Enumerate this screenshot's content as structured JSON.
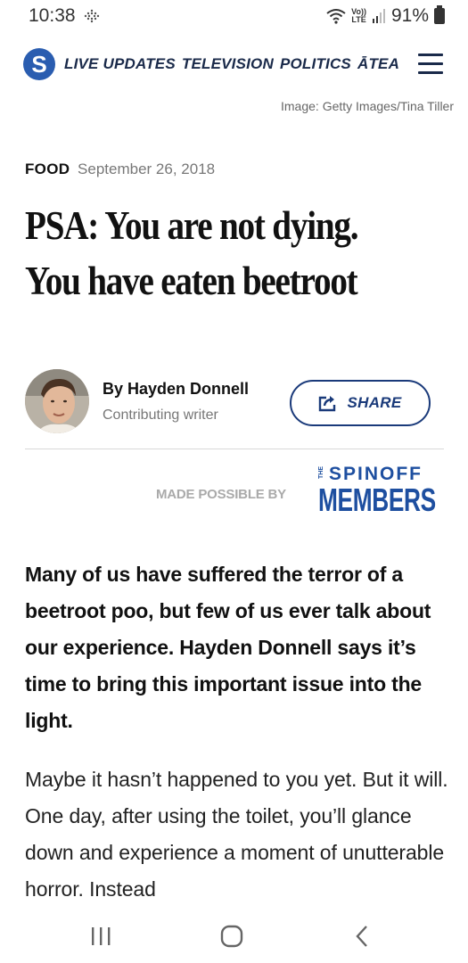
{
  "status": {
    "time": "10:38",
    "volte_top": "Vo))",
    "volte_bottom": "LTE",
    "battery": "91%"
  },
  "header": {
    "logo_letter": "S",
    "nav": [
      "LIVE UPDATES",
      "TELEVISION",
      "POLITICS",
      "ĀTEA"
    ]
  },
  "image_credit": "Image: Getty Images/Tina Tiller",
  "article": {
    "category": "FOOD",
    "date": "September 26, 2018",
    "headline_line1": "PSA: You are not dying.",
    "headline_line2": "You have eaten beetroot",
    "author_name": "By Hayden Donnell",
    "author_role": "Contributing writer",
    "share_label": "SHARE",
    "intro": "Many of us have suffered the terror of a beetroot poo, but few of us ever talk about our experience. Hayden Donnell says it’s time to bring this important issue into the light.",
    "body": "Maybe it hasn’t happened to you yet. But it will. One day, after using the toilet, you’ll glance down and experience a moment of unutterable horror. Instead"
  },
  "sponsor": {
    "made_possible": "MADE POSSIBLE BY",
    "the": "THE",
    "spinoff": "SPINOFF",
    "members": "MEMBERS"
  },
  "colors": {
    "brand_blue": "#2a5db0",
    "navy": "#1a3a7a",
    "members_blue": "#1e4fa0"
  }
}
